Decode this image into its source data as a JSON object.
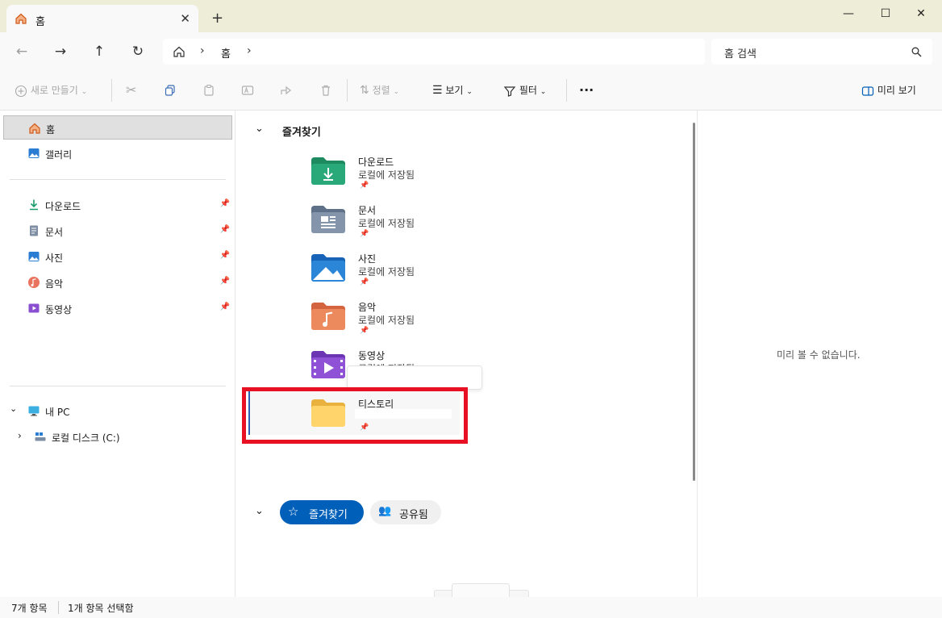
{
  "tab": {
    "title": "홈"
  },
  "window": {
    "minimize": "—",
    "maximize": "☐",
    "close": "✕",
    "new_tab": "+"
  },
  "nav": {
    "back": "←",
    "forward": "→",
    "up": "↑",
    "refresh": "↻",
    "breadcrumb": "홈",
    "separator1": "›",
    "separator2": "›"
  },
  "search": {
    "placeholder": "홈 검색"
  },
  "toolbar": {
    "new_label": "새로 만들기",
    "sort_label": "정렬",
    "view_label": "보기",
    "filter_label": "필터",
    "more_label": "···",
    "preview_label": "미리 보기"
  },
  "sidebar": {
    "home": "홈",
    "gallery": "갤러리",
    "quick": [
      {
        "label": "다운로드",
        "icon": "download-icon"
      },
      {
        "label": "문서",
        "icon": "document-icon"
      },
      {
        "label": "사진",
        "icon": "pictures-icon"
      },
      {
        "label": "음악",
        "icon": "music-icon"
      },
      {
        "label": "동영상",
        "icon": "video-icon"
      }
    ],
    "this_pc": "내 PC",
    "local_disk": "로컬 디스크 (C:)"
  },
  "main": {
    "section_title": "즐겨찾기",
    "items": [
      {
        "name": "다운로드",
        "sub": "로컬에 저장됨"
      },
      {
        "name": "문서",
        "sub": "로컬에 저장됨"
      },
      {
        "name": "사진",
        "sub": "로컬에 저장됨"
      },
      {
        "name": "음악",
        "sub": "로컬에 저장됨"
      },
      {
        "name": "동영상",
        "sub": "로컬에 저장됨"
      },
      {
        "name": "티스토리",
        "sub": ""
      }
    ],
    "filter_tabs": {
      "favorites": "즐겨찾기",
      "shared": "공유됨"
    }
  },
  "preview": {
    "empty_text": "미리 볼 수 없습니다."
  },
  "status": {
    "count": "7개 항목",
    "selected": "1개 항목 선택함"
  },
  "colors": {
    "accent": "#005fb8",
    "highlight_box": "#e81123",
    "titlebar": "#eeeed8"
  }
}
